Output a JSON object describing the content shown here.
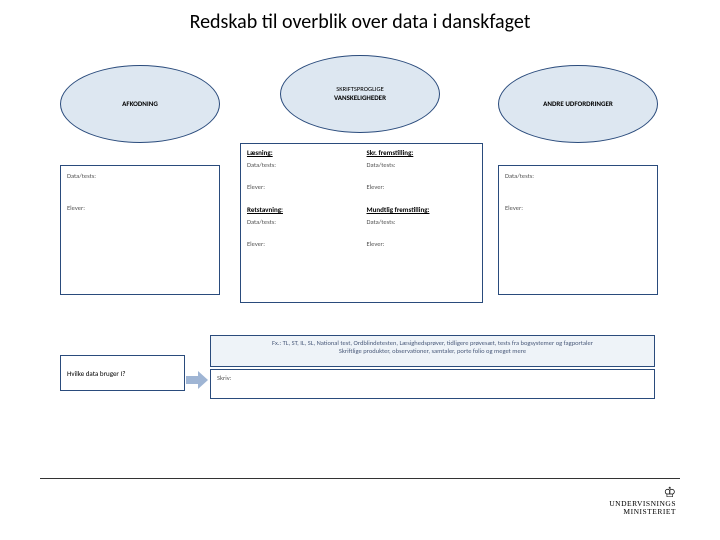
{
  "title": "Redskab til overblik over data i danskfaget",
  "ellipses": {
    "left": "AFKODNING",
    "center_sub": "SKRIFTSPROGLIGE",
    "center_main": "VANSKELIGHEDER",
    "right": "ANDRE UDFORDRINGER"
  },
  "labels": {
    "data_tests": "Data/tests:",
    "elever": "Elever:",
    "laesning": "Læsning:",
    "skr_frem": "Skr. fremstilling:",
    "retstavning": "Retstavning:",
    "mundtlig": "Mundtlig fremstilling:"
  },
  "bottom": {
    "info_line1": "Fx.: TL, ST, IL, SL, National test, Ordblindetesten, Læsighedsprøver, tidligere prøvesæt, tests fra bogsystemer og fagportaler",
    "info_line2": "Skriftlige produkter, observationer, samtaler, porte folio og meget mere",
    "question": "Hvilke data bruger I?",
    "write": "Skriv:"
  },
  "footer": {
    "logo_top": "UNDERVISNINGS",
    "logo_bottom": "MINISTERIET"
  }
}
